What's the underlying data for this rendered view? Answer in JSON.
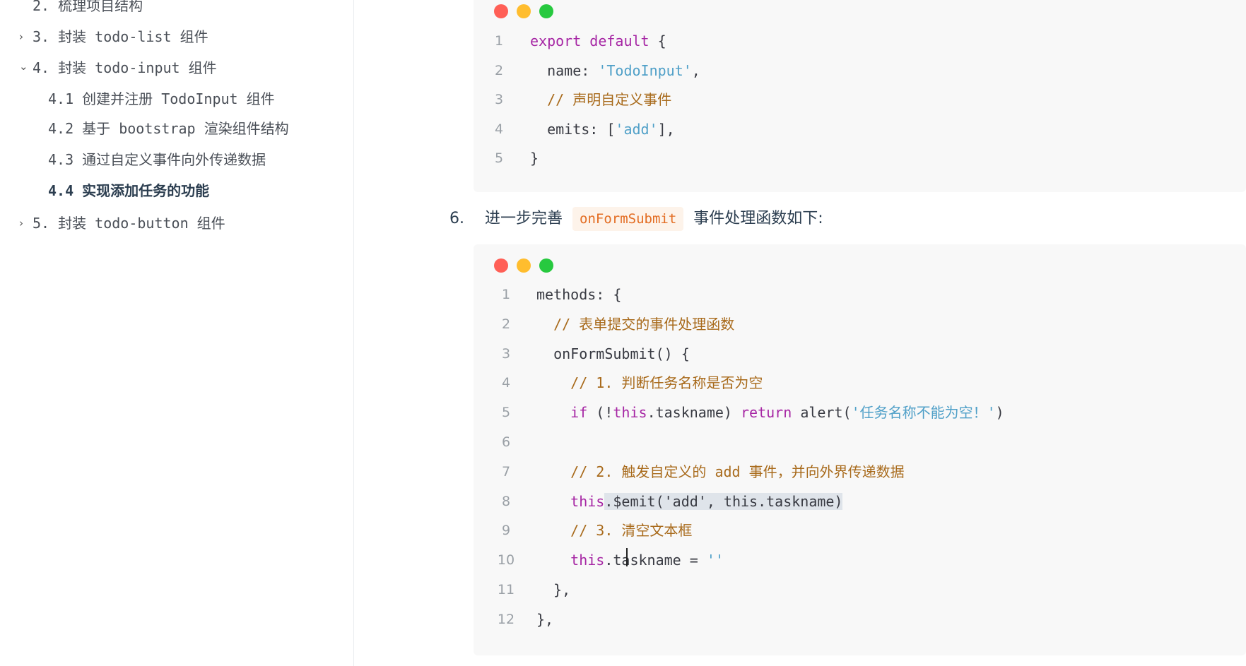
{
  "sidebar": {
    "items": [
      {
        "arrow": "",
        "label": "2. 梳理项目结构"
      },
      {
        "arrow": "›",
        "label": "3. 封装 todo-list 组件"
      },
      {
        "arrow": "⌄",
        "label": "4. 封装 todo-input 组件"
      },
      {
        "arrow": "",
        "label": "4.1 创建并注册 TodoInput 组件"
      },
      {
        "arrow": "",
        "label": "4.2 基于 bootstrap 渲染组件结构"
      },
      {
        "arrow": "",
        "label": "4.3 通过自定义事件向外传递数据"
      },
      {
        "arrow": "",
        "label": "4.4 实现添加任务的功能"
      },
      {
        "arrow": "›",
        "label": "5. 封装 todo-button 组件"
      }
    ]
  },
  "code_block_1": {
    "lines": [
      {
        "n": "1",
        "parts": [
          [
            "kw",
            "export default "
          ],
          [
            "punc",
            "{"
          ]
        ]
      },
      {
        "n": "2",
        "parts": [
          [
            "plain",
            "  name: "
          ],
          [
            "str",
            "'TodoInput'"
          ],
          [
            "punc",
            ","
          ]
        ]
      },
      {
        "n": "3",
        "parts": [
          [
            "comment",
            "  // 声明自定义事件"
          ]
        ]
      },
      {
        "n": "4",
        "parts": [
          [
            "plain",
            "  emits: ["
          ],
          [
            "str",
            "'add'"
          ],
          [
            "punc",
            "],"
          ]
        ]
      },
      {
        "n": "5",
        "parts": [
          [
            "punc",
            "}"
          ]
        ]
      }
    ]
  },
  "step": {
    "number": "6.",
    "before": "进一步完善",
    "code": "onFormSubmit",
    "after": "事件处理函数如下:"
  },
  "code_block_2": {
    "lines": [
      {
        "n": "1",
        "parts": [
          [
            "plain",
            "methods: {"
          ]
        ]
      },
      {
        "n": "2",
        "parts": [
          [
            "comment",
            "  // 表单提交的事件处理函数"
          ]
        ]
      },
      {
        "n": "3",
        "parts": [
          [
            "plain",
            "  onFormSubmit() {"
          ]
        ]
      },
      {
        "n": "4",
        "parts": [
          [
            "comment",
            "    // 1. 判断任务名称是否为空"
          ]
        ]
      },
      {
        "n": "5",
        "parts": [
          [
            "kw",
            "    if "
          ],
          [
            "plain",
            "(!"
          ],
          [
            "kw",
            "this"
          ],
          [
            "plain",
            ".taskname) "
          ],
          [
            "kw",
            "return "
          ],
          [
            "plain",
            "alert("
          ],
          [
            "str",
            "'任务名称不能为空！'"
          ],
          [
            "plain",
            ")"
          ]
        ]
      },
      {
        "n": "6",
        "parts": []
      },
      {
        "n": "7",
        "parts": [
          [
            "comment",
            "    // 2. 触发自定义的 add 事件，并向外界传递数据"
          ]
        ]
      },
      {
        "n": "8",
        "parts": [
          [
            "kw",
            "    this"
          ],
          [
            "plain highlight",
            ".$emit('add', this.taskname)"
          ]
        ]
      },
      {
        "n": "9",
        "parts": [
          [
            "comment",
            "    // 3. 清空文本框"
          ]
        ]
      },
      {
        "n": "10",
        "parts": [
          [
            "kw",
            "    this"
          ],
          [
            "plain",
            ".taskname = "
          ],
          [
            "str",
            "''"
          ]
        ]
      },
      {
        "n": "11",
        "parts": [
          [
            "plain",
            "  },"
          ]
        ]
      },
      {
        "n": "12",
        "parts": [
          [
            "plain",
            "},"
          ]
        ]
      }
    ]
  }
}
